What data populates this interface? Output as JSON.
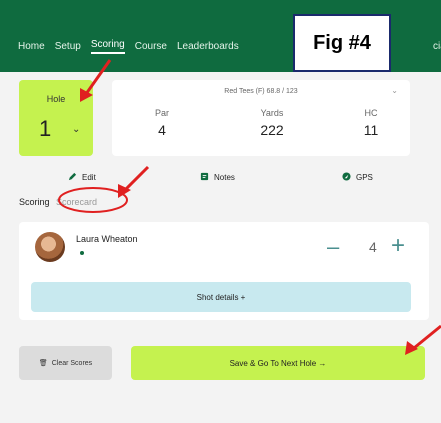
{
  "nav": {
    "items": [
      "Home",
      "Setup",
      "Scoring",
      "Course",
      "Leaderboards"
    ],
    "active_index": 2,
    "tail_text": "cial"
  },
  "figure_label": "Fig #4",
  "hole": {
    "label": "Hole",
    "number": "1",
    "chevron": "⌄"
  },
  "tee": {
    "label": "Red Tees (F)  68.8 / 123",
    "chevron": "⌄",
    "stats": [
      {
        "label": "Par",
        "value": "4"
      },
      {
        "label": "Yards",
        "value": "222"
      },
      {
        "label": "HC",
        "value": "11"
      }
    ]
  },
  "actions": {
    "edit": {
      "label": "Edit",
      "icon": "pencil-icon"
    },
    "notes": {
      "label": "Notes",
      "icon": "notes-icon"
    },
    "gps": {
      "label": "GPS",
      "icon": "gps-icon"
    }
  },
  "tabs": {
    "scoring": "Scoring",
    "scorecard": "Scorecard"
  },
  "player": {
    "name": "Laura Wheaton",
    "minus": "–",
    "score": "4",
    "plus": "+"
  },
  "shot_details": "Shot details  +",
  "buttons": {
    "clear": "Clear Scores",
    "clear_icon": "🗑",
    "save": "Save & Go To Next Hole →"
  },
  "colors": {
    "header_green": "#0f6b3f",
    "lime": "#c5f24f",
    "annotation_red": "#e02020",
    "shot_bg": "#c8e9ef"
  }
}
